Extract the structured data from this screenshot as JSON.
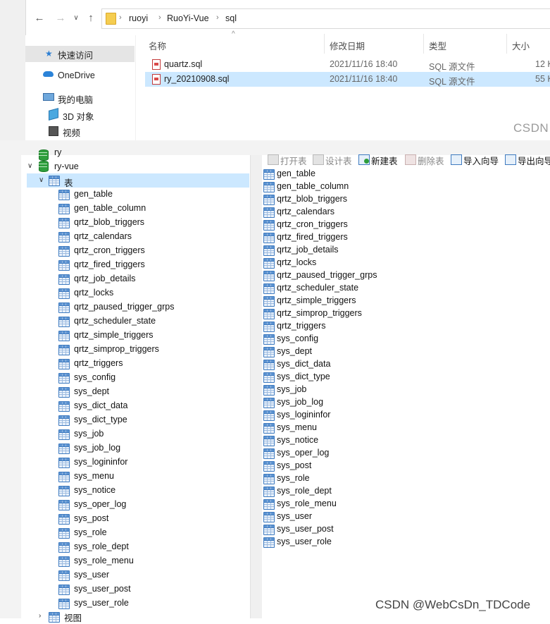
{
  "explorer": {
    "breadcrumb": [
      "ruoyi",
      "RuoYi-Vue",
      "sql"
    ],
    "nav_pane": [
      "快速访问",
      "OneDrive",
      "我的电脑",
      "3D 对象",
      "视频"
    ],
    "columns": {
      "name": "名称",
      "date": "修改日期",
      "type": "类型",
      "size": "大小"
    },
    "files": [
      {
        "name": "quartz.sql",
        "date": "2021/11/16 18:40",
        "type": "SQL 源文件",
        "size": "12 K"
      },
      {
        "name": "ry_20210908.sql",
        "date": "2021/11/16 18:40",
        "type": "SQL 源文件",
        "size": "55 K"
      }
    ],
    "csdn_mark": "CSDN",
    "sort_glyph": "^"
  },
  "navicat": {
    "toolbar": [
      "打开表",
      "设计表",
      "新建表",
      "删除表",
      "导入向导",
      "导出向导"
    ],
    "tree": {
      "prev_db": "ry",
      "database": "ry-vue",
      "tables_node": "表",
      "views_node": "视图"
    },
    "tables": [
      "gen_table",
      "gen_table_column",
      "qrtz_blob_triggers",
      "qrtz_calendars",
      "qrtz_cron_triggers",
      "qrtz_fired_triggers",
      "qrtz_job_details",
      "qrtz_locks",
      "qrtz_paused_trigger_grps",
      "qrtz_scheduler_state",
      "qrtz_simple_triggers",
      "qrtz_simprop_triggers",
      "qrtz_triggers",
      "sys_config",
      "sys_dept",
      "sys_dict_data",
      "sys_dict_type",
      "sys_job",
      "sys_job_log",
      "sys_logininfor",
      "sys_menu",
      "sys_notice",
      "sys_oper_log",
      "sys_post",
      "sys_role",
      "sys_role_dept",
      "sys_role_menu",
      "sys_user",
      "sys_user_post",
      "sys_user_role"
    ]
  },
  "watermark": "CSDN @WebCsDn_TDCode"
}
